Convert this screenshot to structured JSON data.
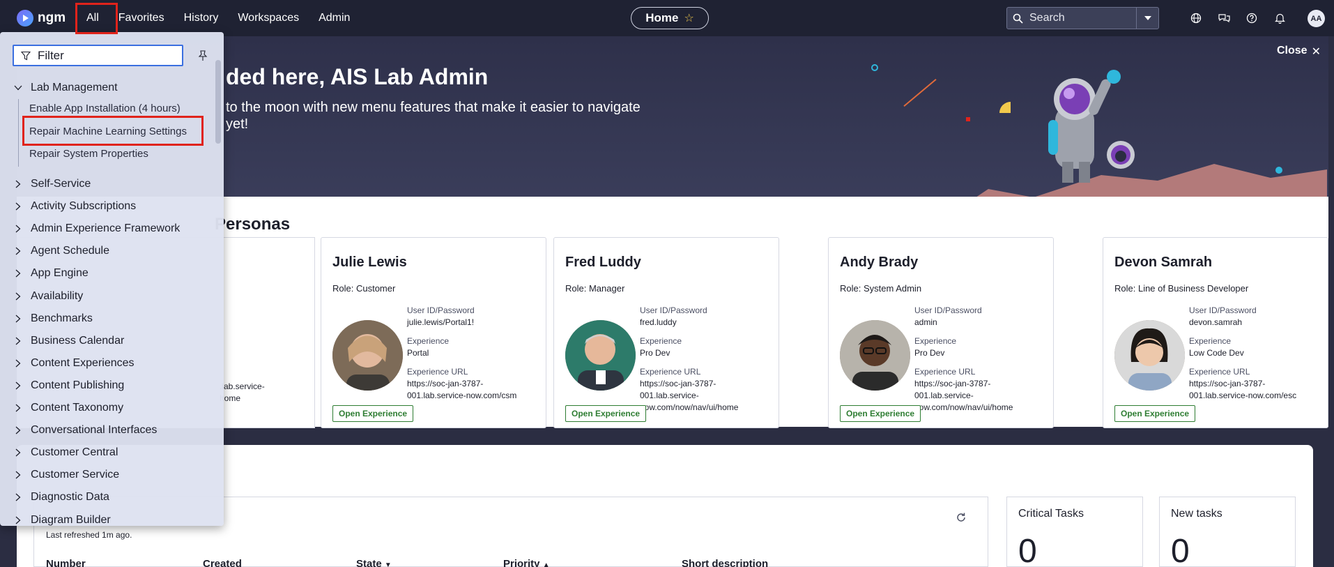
{
  "nav": {
    "brand": "ngm",
    "items": [
      "All",
      "Favorites",
      "History",
      "Workspaces",
      "Admin"
    ],
    "home_label": "Home",
    "search_placeholder": "Search",
    "avatar_initials": "AA"
  },
  "hero": {
    "title": "So glad you've landed here, AIS Lab Admin",
    "title_visible": "ded here, AIS Lab Admin",
    "text_line1": "to the moon with new menu features that make it easier to navigate",
    "text_line2": "yet!",
    "close_label": "Close"
  },
  "personas": {
    "section_title": "Personas",
    "partial_card": {
      "url_line1": ".lab.service-",
      "url_line2": "home"
    },
    "cards": [
      {
        "name": "Julie Lewis",
        "role": "Role: Customer",
        "cred_label": "User ID/Password",
        "cred": "julie.lewis/Portal1!",
        "exp_label": "Experience",
        "exp": "Portal",
        "url_label": "Experience URL",
        "url1": "https://soc-jan-3787-",
        "url2": "001.lab.service-now.com/csm",
        "button": "Open Experience"
      },
      {
        "name": "Fred Luddy",
        "role": "Role: Manager",
        "cred_label": "User ID/Password",
        "cred": "fred.luddy",
        "exp_label": "Experience",
        "exp": "Pro Dev",
        "url_label": "Experience URL",
        "url1": "https://soc-jan-3787-001.lab.service-",
        "url2": "now.com/now/nav/ui/home",
        "button": "Open Experience"
      },
      {
        "name": "Andy Brady",
        "role": "Role: System Admin",
        "cred_label": "User ID/Password",
        "cred": "admin",
        "exp_label": "Experience",
        "exp": "Pro Dev",
        "url_label": "Experience URL",
        "url1": "https://soc-jan-3787-001.lab.service-",
        "url2": "now.com/now/nav/ui/home",
        "button": "Open Experience"
      },
      {
        "name": "Devon Samrah",
        "role": "Role: Line of Business Developer",
        "cred_label": "User ID/Password",
        "cred": "devon.samrah",
        "exp_label": "Experience",
        "exp": "Low Code Dev",
        "url_label": "Experience URL",
        "url1": "https://soc-jan-3787-",
        "url2": "001.lab.service-now.com/esc",
        "button": "Open Experience"
      }
    ]
  },
  "work": {
    "refreshed": "Last refreshed 1m ago.",
    "columns": [
      "Number",
      "Created",
      "State",
      "Priority",
      "Short description"
    ],
    "kpis": [
      {
        "title": "Critical Tasks",
        "value": "0"
      },
      {
        "title": "New tasks",
        "value": "0"
      }
    ]
  },
  "menu": {
    "filter_placeholder": "Filter",
    "expanded_group": "Lab Management",
    "sub_items": [
      "Enable App Installation (4 hours)",
      "Repair Machine Learning Settings",
      "Repair System Properties"
    ],
    "groups": [
      "Self-Service",
      "Activity Subscriptions",
      "Admin Experience Framework",
      "Agent Schedule",
      "App Engine",
      "Availability",
      "Benchmarks",
      "Business Calendar",
      "Content Experiences",
      "Content Publishing",
      "Content Taxonomy",
      "Conversational Interfaces",
      "Customer Central",
      "Customer Service",
      "Diagnostic Data",
      "Diagram Builder"
    ]
  },
  "colors": {
    "nav_bg": "#1f2233",
    "highlight_box": "#e0231b",
    "button_green": "#2e7d32",
    "filter_focus": "#3b6fe0"
  }
}
